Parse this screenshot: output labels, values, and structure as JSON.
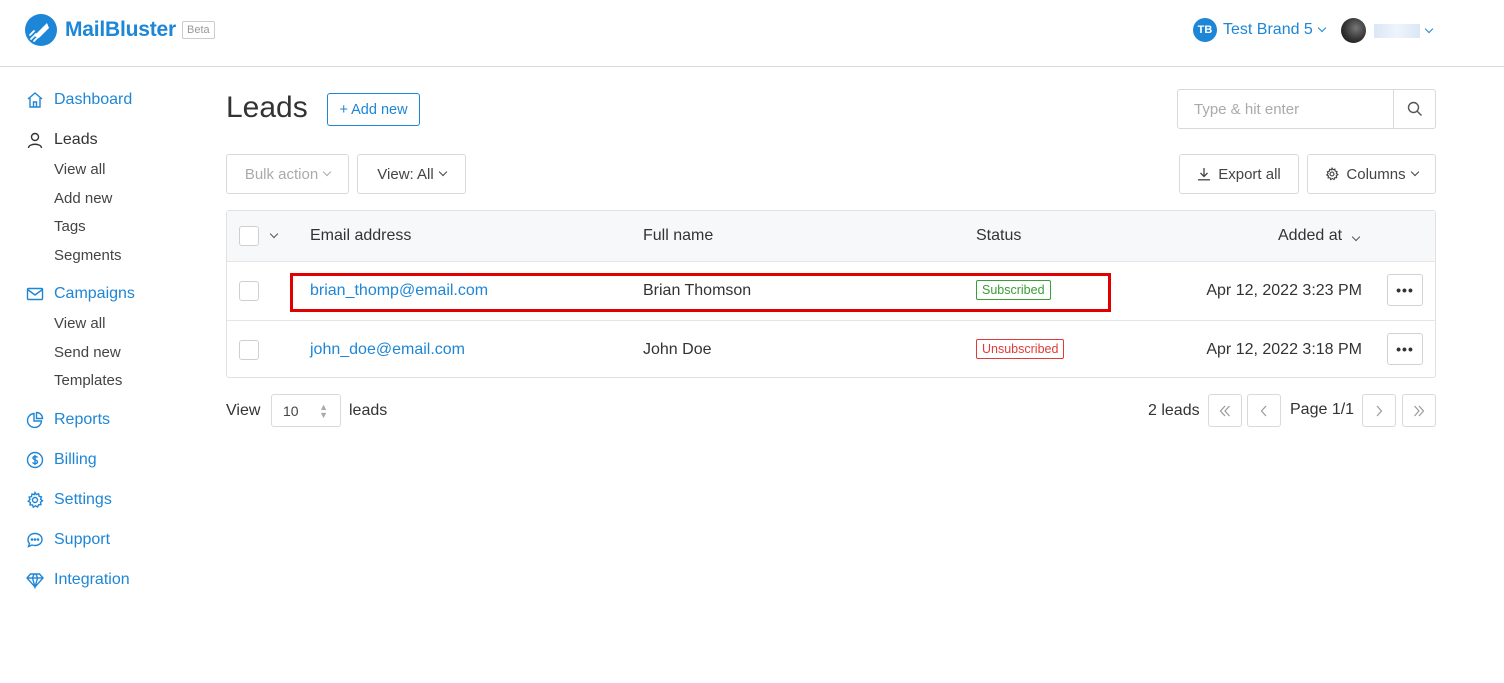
{
  "header": {
    "app_name": "MailBluster",
    "beta_label": "Beta",
    "brand_initials": "TB",
    "brand_name": "Test Brand 5"
  },
  "sidebar": {
    "dashboard": "Dashboard",
    "leads": {
      "label": "Leads",
      "items": [
        "View all",
        "Add new",
        "Tags",
        "Segments"
      ]
    },
    "campaigns": {
      "label": "Campaigns",
      "items": [
        "View all",
        "Send new",
        "Templates"
      ]
    },
    "reports": "Reports",
    "billing": "Billing",
    "settings": "Settings",
    "support": "Support",
    "integration": "Integration"
  },
  "main": {
    "title": "Leads",
    "add_new_label": "+ Add new",
    "search_placeholder": "Type & hit enter",
    "bulk_action_label": "Bulk action",
    "view_label": "View: All",
    "export_label": "Export all",
    "columns_label": "Columns"
  },
  "table": {
    "headers": {
      "email": "Email address",
      "name": "Full name",
      "status": "Status",
      "added_at": "Added at"
    },
    "rows": [
      {
        "email": "brian_thomp@email.com",
        "name": "Brian Thomson",
        "status": "Subscribed",
        "added_at": "Apr 12, 2022 3:23 PM",
        "more": "•••"
      },
      {
        "email": "john_doe@email.com",
        "name": "John Doe",
        "status": "Unsubscribed",
        "added_at": "Apr 12, 2022 3:18 PM",
        "more": "•••"
      }
    ]
  },
  "footer": {
    "view_label": "View",
    "page_size": "10",
    "leads_label": "leads",
    "total": "2 leads",
    "page_label": "Page 1/1"
  },
  "colors": {
    "accent": "#1e86d6",
    "subscribed": "#3a9e34",
    "unsubscribed": "#e03a3a",
    "highlight": "#e00000"
  }
}
